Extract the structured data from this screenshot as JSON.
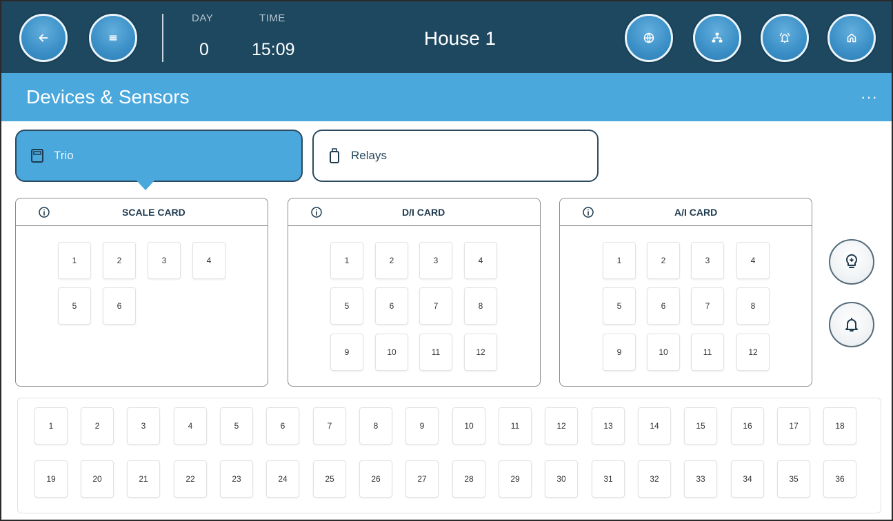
{
  "header": {
    "day_label": "DAY",
    "day_value": "0",
    "time_label": "TIME",
    "time_value": "15:09",
    "house_title": "House 1",
    "icons": [
      "back-arrow-icon",
      "menu-icon",
      "globe-icon",
      "network-icon",
      "alarm-bell-icon",
      "home-icon"
    ]
  },
  "titlebar": {
    "title": "Devices & Sensors",
    "more": "···"
  },
  "tabs": [
    {
      "label": "Trio",
      "active": true
    },
    {
      "label": "Relays",
      "active": false
    }
  ],
  "cards": [
    {
      "title": "SCALE CARD",
      "cells": [
        "1",
        "2",
        "3",
        "4",
        "5",
        "6"
      ]
    },
    {
      "title": "D/I CARD",
      "cells": [
        "1",
        "2",
        "3",
        "4",
        "5",
        "6",
        "7",
        "8",
        "9",
        "10",
        "11",
        "12"
      ]
    },
    {
      "title": "A/I CARD",
      "cells": [
        "1",
        "2",
        "3",
        "4",
        "5",
        "6",
        "7",
        "8",
        "9",
        "10",
        "11",
        "12"
      ]
    }
  ],
  "relay_cells": [
    "1",
    "2",
    "3",
    "4",
    "5",
    "6",
    "7",
    "8",
    "9",
    "10",
    "11",
    "12",
    "13",
    "14",
    "15",
    "16",
    "17",
    "18",
    "19",
    "20",
    "21",
    "22",
    "23",
    "24",
    "25",
    "26",
    "27",
    "28",
    "29",
    "30",
    "31",
    "32",
    "33",
    "34",
    "35",
    "36"
  ],
  "colors": {
    "header_bg": "#1e4760",
    "accent": "#4aa8dc"
  }
}
